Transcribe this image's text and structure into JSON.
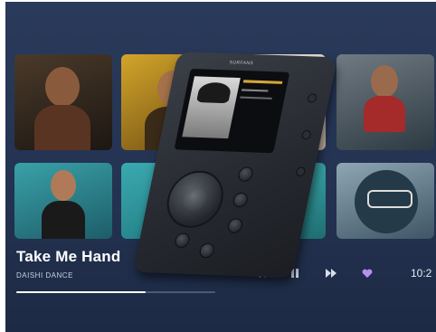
{
  "now_playing": {
    "title": "Take Me Hand",
    "artist": "DAISHI DANCE",
    "progress_percent": 65
  },
  "controls": {
    "prev_icon": "rewind-icon",
    "pause_icon": "pause-icon",
    "next_icon": "fast-forward-icon",
    "favorite_icon": "heart-icon",
    "time": "10:2"
  },
  "device": {
    "brand": "SURFANS"
  },
  "colors": {
    "background": "#243352",
    "accent_heart": "#b98ef0",
    "progress": "#ffffff"
  }
}
